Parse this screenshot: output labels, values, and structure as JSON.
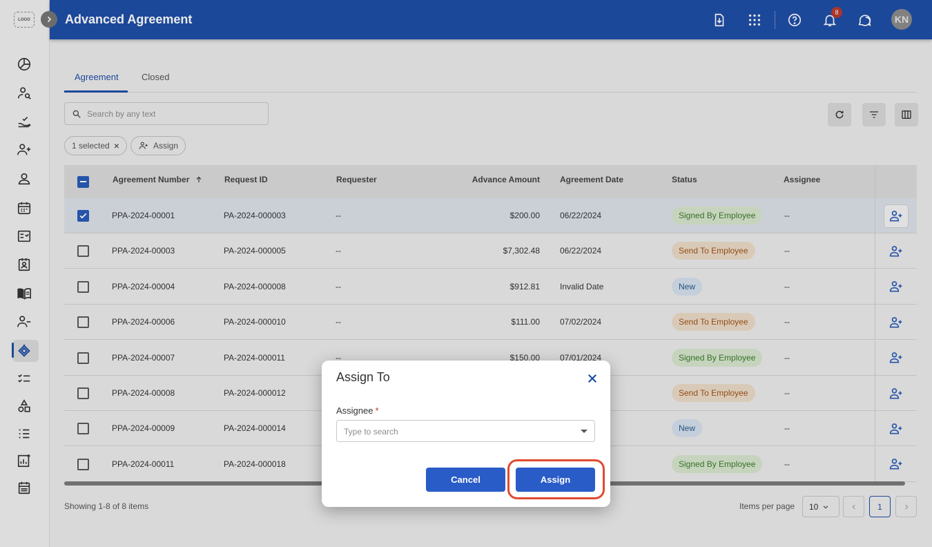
{
  "app": {
    "logo_text": "LOGO",
    "title": "Advanced Agreement",
    "notification_count": "8",
    "avatar_initials": "KN"
  },
  "sidebar": {
    "icons": [
      "dashboard-icon",
      "user-search-icon",
      "hand-check-icon",
      "add-user-icon",
      "person-icon",
      "calendar-grid-icon",
      "checklist-doc-icon",
      "id-card-icon",
      "book-icon",
      "user-minus-icon",
      "agreement-handshake-icon",
      "task-list-icon",
      "shapes-icon",
      "ordered-list-icon",
      "analytics-icon",
      "schedule-icon"
    ],
    "active_index": 10
  },
  "tabs": [
    {
      "label": "Agreement",
      "active": true
    },
    {
      "label": "Closed",
      "active": false
    }
  ],
  "search": {
    "placeholder": "Search by any text"
  },
  "selection": {
    "chip_label": "1 selected",
    "assign_label": "Assign"
  },
  "table": {
    "columns": [
      "Agreement Number",
      "Request ID",
      "Requester",
      "Advance Amount",
      "Agreement Date",
      "Status",
      "Assignee"
    ],
    "rows": [
      {
        "number": "PPA-2024-00001",
        "request_id": "PA-2024-000003",
        "requester": "--",
        "amount": "$200.00",
        "date": "06/22/2024",
        "status": "Signed By Employee",
        "assignee": "--",
        "selected": true
      },
      {
        "number": "PPA-2024-00003",
        "request_id": "PA-2024-000005",
        "requester": "--",
        "amount": "$7,302.48",
        "date": "06/22/2024",
        "status": "Send To Employee",
        "assignee": "--",
        "selected": false
      },
      {
        "number": "PPA-2024-00004",
        "request_id": "PA-2024-000008",
        "requester": "--",
        "amount": "$912.81",
        "date": "Invalid Date",
        "status": "New",
        "assignee": "--",
        "selected": false
      },
      {
        "number": "PPA-2024-00006",
        "request_id": "PA-2024-000010",
        "requester": "--",
        "amount": "$111.00",
        "date": "07/02/2024",
        "status": "Send To Employee",
        "assignee": "--",
        "selected": false
      },
      {
        "number": "PPA-2024-00007",
        "request_id": "PA-2024-000011",
        "requester": "--",
        "amount": "$150.00",
        "date": "07/01/2024",
        "status": "Signed By Employee",
        "assignee": "--",
        "selected": false
      },
      {
        "number": "PPA-2024-00008",
        "request_id": "PA-2024-000012",
        "requester": "",
        "amount": "",
        "date": "",
        "status": "Send To Employee",
        "assignee": "--",
        "selected": false
      },
      {
        "number": "PPA-2024-00009",
        "request_id": "PA-2024-000014",
        "requester": "",
        "amount": "",
        "date": "",
        "status": "New",
        "assignee": "--",
        "selected": false
      },
      {
        "number": "PPA-2024-00011",
        "request_id": "PA-2024-000018",
        "requester": "",
        "amount": "",
        "date": "",
        "status": "Signed By Employee",
        "assignee": "--",
        "selected": false
      }
    ]
  },
  "footer": {
    "showing": "Showing 1-8 of 8 items",
    "items_per_page_label": "Items per page",
    "items_per_page_value": "10",
    "current_page": "1"
  },
  "modal": {
    "title": "Assign To",
    "field_label": "Assignee",
    "required_mark": "*",
    "field_placeholder": "Type to search",
    "cancel_label": "Cancel",
    "assign_label": "Assign"
  },
  "colors": {
    "primary": "#1f4fa8",
    "button": "#2a5cc8",
    "highlight": "#e04a30",
    "status_green": "#3c7a2a",
    "status_orange": "#a0521b",
    "status_blue": "#2a5a8f"
  }
}
